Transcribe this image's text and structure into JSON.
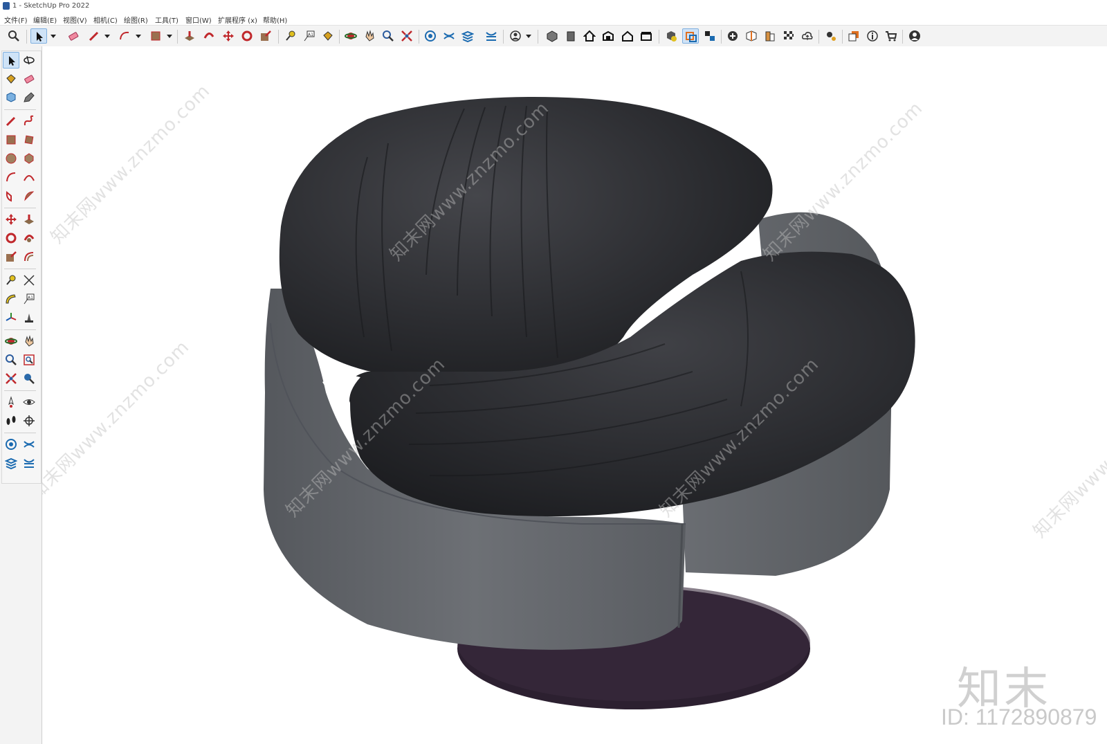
{
  "window": {
    "title": "1 - SketchUp Pro 2022"
  },
  "menu": [
    "文件(F)",
    "编辑(E)",
    "视图(V)",
    "相机(C)",
    "绘图(R)",
    "工具(T)",
    "窗口(W)",
    "扩展程序 (x)",
    "帮助(H)"
  ],
  "toolbar_icons": [
    "zoom-icon",
    "select-icon",
    "eraser-icon",
    "pencil-icon",
    "arc-icon",
    "rectangle-icon",
    "push-pull-icon",
    "follow-me-icon",
    "move-icon",
    "rotate-icon",
    "scale-icon",
    "tape-measure-icon",
    "text-icon",
    "paint-bucket-icon",
    "orbit-icon",
    "pan-icon",
    "zoom-tool-icon",
    "zoom-extents-icon",
    "sandbox-from-contours-icon",
    "sandbox-smoove-icon",
    "sandbox-stamp-icon",
    "sandbox-drape-icon",
    "account-icon",
    "iso-view-icon",
    "front-view-icon",
    "home-view-icon",
    "right-view-icon",
    "back-view-icon",
    "left-view-icon",
    "components-icon",
    "section-plane-icon",
    "section-display-icon",
    "add-location-icon",
    "styles-icon",
    "shadows-icon",
    "fog-icon",
    "cloud-upload-icon",
    "preferences-icon",
    "outliner-icon",
    "model-info-icon",
    "warehouse-icon",
    "profile-icon"
  ],
  "left_tools": [
    "select-icon",
    "orbit-icon",
    "paint-bucket-icon",
    "eraser-icon",
    "component-icon",
    "tag-icon",
    "pencil-icon",
    "freehand-icon",
    "rectangle-icon",
    "rotated-rect-icon",
    "circle-icon",
    "polygon-icon",
    "arc-icon",
    "2pt-arc-icon",
    "pie-icon",
    "3pt-arc-icon",
    "move-icon",
    "push-pull-icon",
    "rotate-icon",
    "follow-me-icon",
    "scale-icon",
    "offset-icon",
    "tape-measure-icon",
    "dimension-icon",
    "protractor-icon",
    "text-icon",
    "axes-icon",
    "3d-text-icon",
    "orbit-tool-icon",
    "pan-icon",
    "zoom-icon",
    "zoom-window-icon",
    "zoom-extents-icon",
    "previous-view-icon",
    "position-camera-icon",
    "look-around-icon",
    "walk-icon",
    "section-plane-icon",
    "sandbox-contours-icon",
    "sandbox-smoove-icon",
    "sandbox-stamp-icon",
    "sandbox-drape-icon"
  ],
  "watermark": {
    "text": "知末网www.znzmo.com",
    "brand": "知末",
    "id": "ID: 1172890879"
  },
  "colors": {
    "upholstery": "#2b2c30",
    "shell": "#6a6d72",
    "base": "#2c2030"
  }
}
